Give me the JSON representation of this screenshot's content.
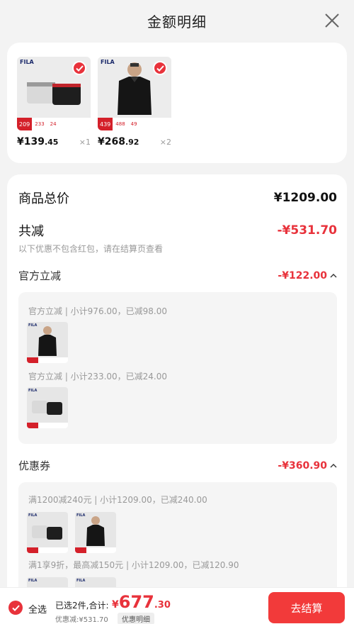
{
  "header": {
    "title": "金额明细"
  },
  "products": [
    {
      "brand": "FILA",
      "price_int": "¥139",
      "price_dec": ".45",
      "qty": "×1",
      "tag_price": "209",
      "tag_a": "233",
      "tag_b": "24",
      "kind": "underwear"
    },
    {
      "brand": "FILA",
      "price_int": "¥268",
      "price_dec": ".92",
      "qty": "×2",
      "tag_price": "439",
      "tag_a": "488",
      "tag_b": "49",
      "kind": "polo"
    }
  ],
  "summary": {
    "total_label": "商品总价",
    "total_value": "¥1209.00",
    "discount_label": "共减",
    "discount_value": "-¥531.70",
    "discount_note": "以下优惠不包含红包，请在结算页查看"
  },
  "official": {
    "label": "官方立减",
    "value": "-¥122.00",
    "line1": "官方立减 | 小计976.00，已减98.00",
    "line2": "官方立减 | 小计233.00，已减24.00"
  },
  "coupon": {
    "label": "优惠券",
    "value": "-¥360.90",
    "line1": "满1200减240元 | 小计1209.00，已减240.00",
    "line2": "满1享9折，最高减150元 | 小计1209.00，已减120.90"
  },
  "footer": {
    "select_all": "全选",
    "selected_text": "已选2件,合计:",
    "total_symbol": "¥",
    "total_int": "677",
    "total_dec": ".30",
    "discount_text": "优惠减:¥531.70",
    "discount_detail_btn": "优惠明细",
    "checkout_btn": "去结算"
  },
  "colors": {
    "accent": "#e8323b",
    "button": "#f23a3a"
  }
}
